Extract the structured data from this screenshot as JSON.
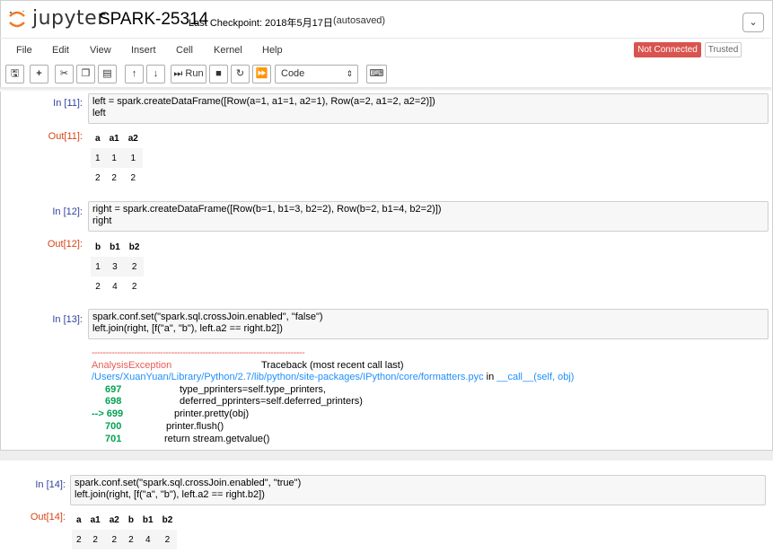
{
  "header": {
    "logo_text": "jupyter",
    "notebook_title": "SPARK-25314",
    "checkpoint_label": "Last Checkpoint: 2018年5月17日",
    "autosave_status": "(autosaved)",
    "kernel_icon": "chevron-down-icon"
  },
  "menu": {
    "items": [
      "File",
      "Edit",
      "View",
      "Insert",
      "Cell",
      "Kernel",
      "Help"
    ],
    "status_badge": "Not Connected",
    "trusted_badge": "Trusted"
  },
  "toolbar": {
    "run_label": "Run",
    "cell_type": "Code",
    "icons": [
      "save-icon",
      "plus-icon",
      "cut-icon",
      "copy-icon",
      "paste-icon",
      "arrow-up-icon",
      "arrow-down-icon",
      "step-forward-icon",
      "stop-icon",
      "restart-icon",
      "fast-forward-icon",
      "keyboard-icon"
    ]
  },
  "cells": [
    {
      "in_prompt": "In [11]:",
      "out_prompt": "Out[11]:",
      "headers": [
        "a",
        "a1",
        "a2"
      ],
      "rows": [
        [
          "1",
          "1",
          "1"
        ],
        [
          "2",
          "2",
          "2"
        ]
      ]
    },
    {
      "in_prompt": "In [12]:",
      "out_prompt": "Out[12]:",
      "headers": [
        "b",
        "b1",
        "b2"
      ],
      "rows": [
        [
          "1",
          "3",
          "2"
        ],
        [
          "2",
          "4",
          "2"
        ]
      ]
    },
    {
      "in_prompt": "In [13]:",
      "error_name": "AnalysisException",
      "traceback_header": "Traceback (most recent call last)",
      "file_path": "/Users/XuanYuan/Library/Python/2.7/lib/python/site-packages/IPython/core/formatters.pyc",
      "file_in": " in ",
      "func_sig": "__call__(self, obj)",
      "lines": [
        {
          "no": "697",
          "code": "type_pprinters=self.type_printers,"
        },
        {
          "no": "698",
          "code": "deferred_pprinters=self.deferred_printers)"
        },
        {
          "no": "--> 699",
          "code": "printer.pretty(obj)"
        },
        {
          "no": "700",
          "code": "printer.flush()"
        },
        {
          "no": "701",
          "code": "return stream.getvalue()"
        }
      ]
    },
    {
      "in_prompt": "In [14]:",
      "out_prompt": "Out[14]:",
      "headers": [
        "a",
        "a1",
        "a2",
        "b",
        "b1",
        "b2"
      ],
      "rows": [
        [
          "2",
          "2",
          "2",
          "2",
          "4",
          "2"
        ]
      ]
    }
  ],
  "code": {
    "c11_l1a": "left = spark.createDataFrame([Row(a=1, a1=1, a2=1), Row(a=2, a1=2, a2=2)])",
    "c11_l2": "left",
    "c12_l1": "right = spark.createDataFrame([Row(b=1, b1=3, b2=2), Row(b=2, b1=4, b2=2)])",
    "c12_l2": "right",
    "c13_l1": "spark.conf.set(\"spark.sql.crossJoin.enabled\", \"false\")",
    "c13_l2": "left.join(right, [f(\"a\", \"b\"), left.a2 == right.b2])",
    "c14_l1": "spark.conf.set(\"spark.sql.crossJoin.enabled\", \"true\")",
    "c14_l2": "left.join(right, [f(\"a\", \"b\"), left.a2 == right.b2])"
  },
  "colors": {
    "in_prompt": "#303f9f",
    "out_prompt": "#d84315",
    "not_connected": "#d9534f",
    "error_red": "#e75c58",
    "path_blue": "#208ffb",
    "lineno_green": "#00a250"
  }
}
